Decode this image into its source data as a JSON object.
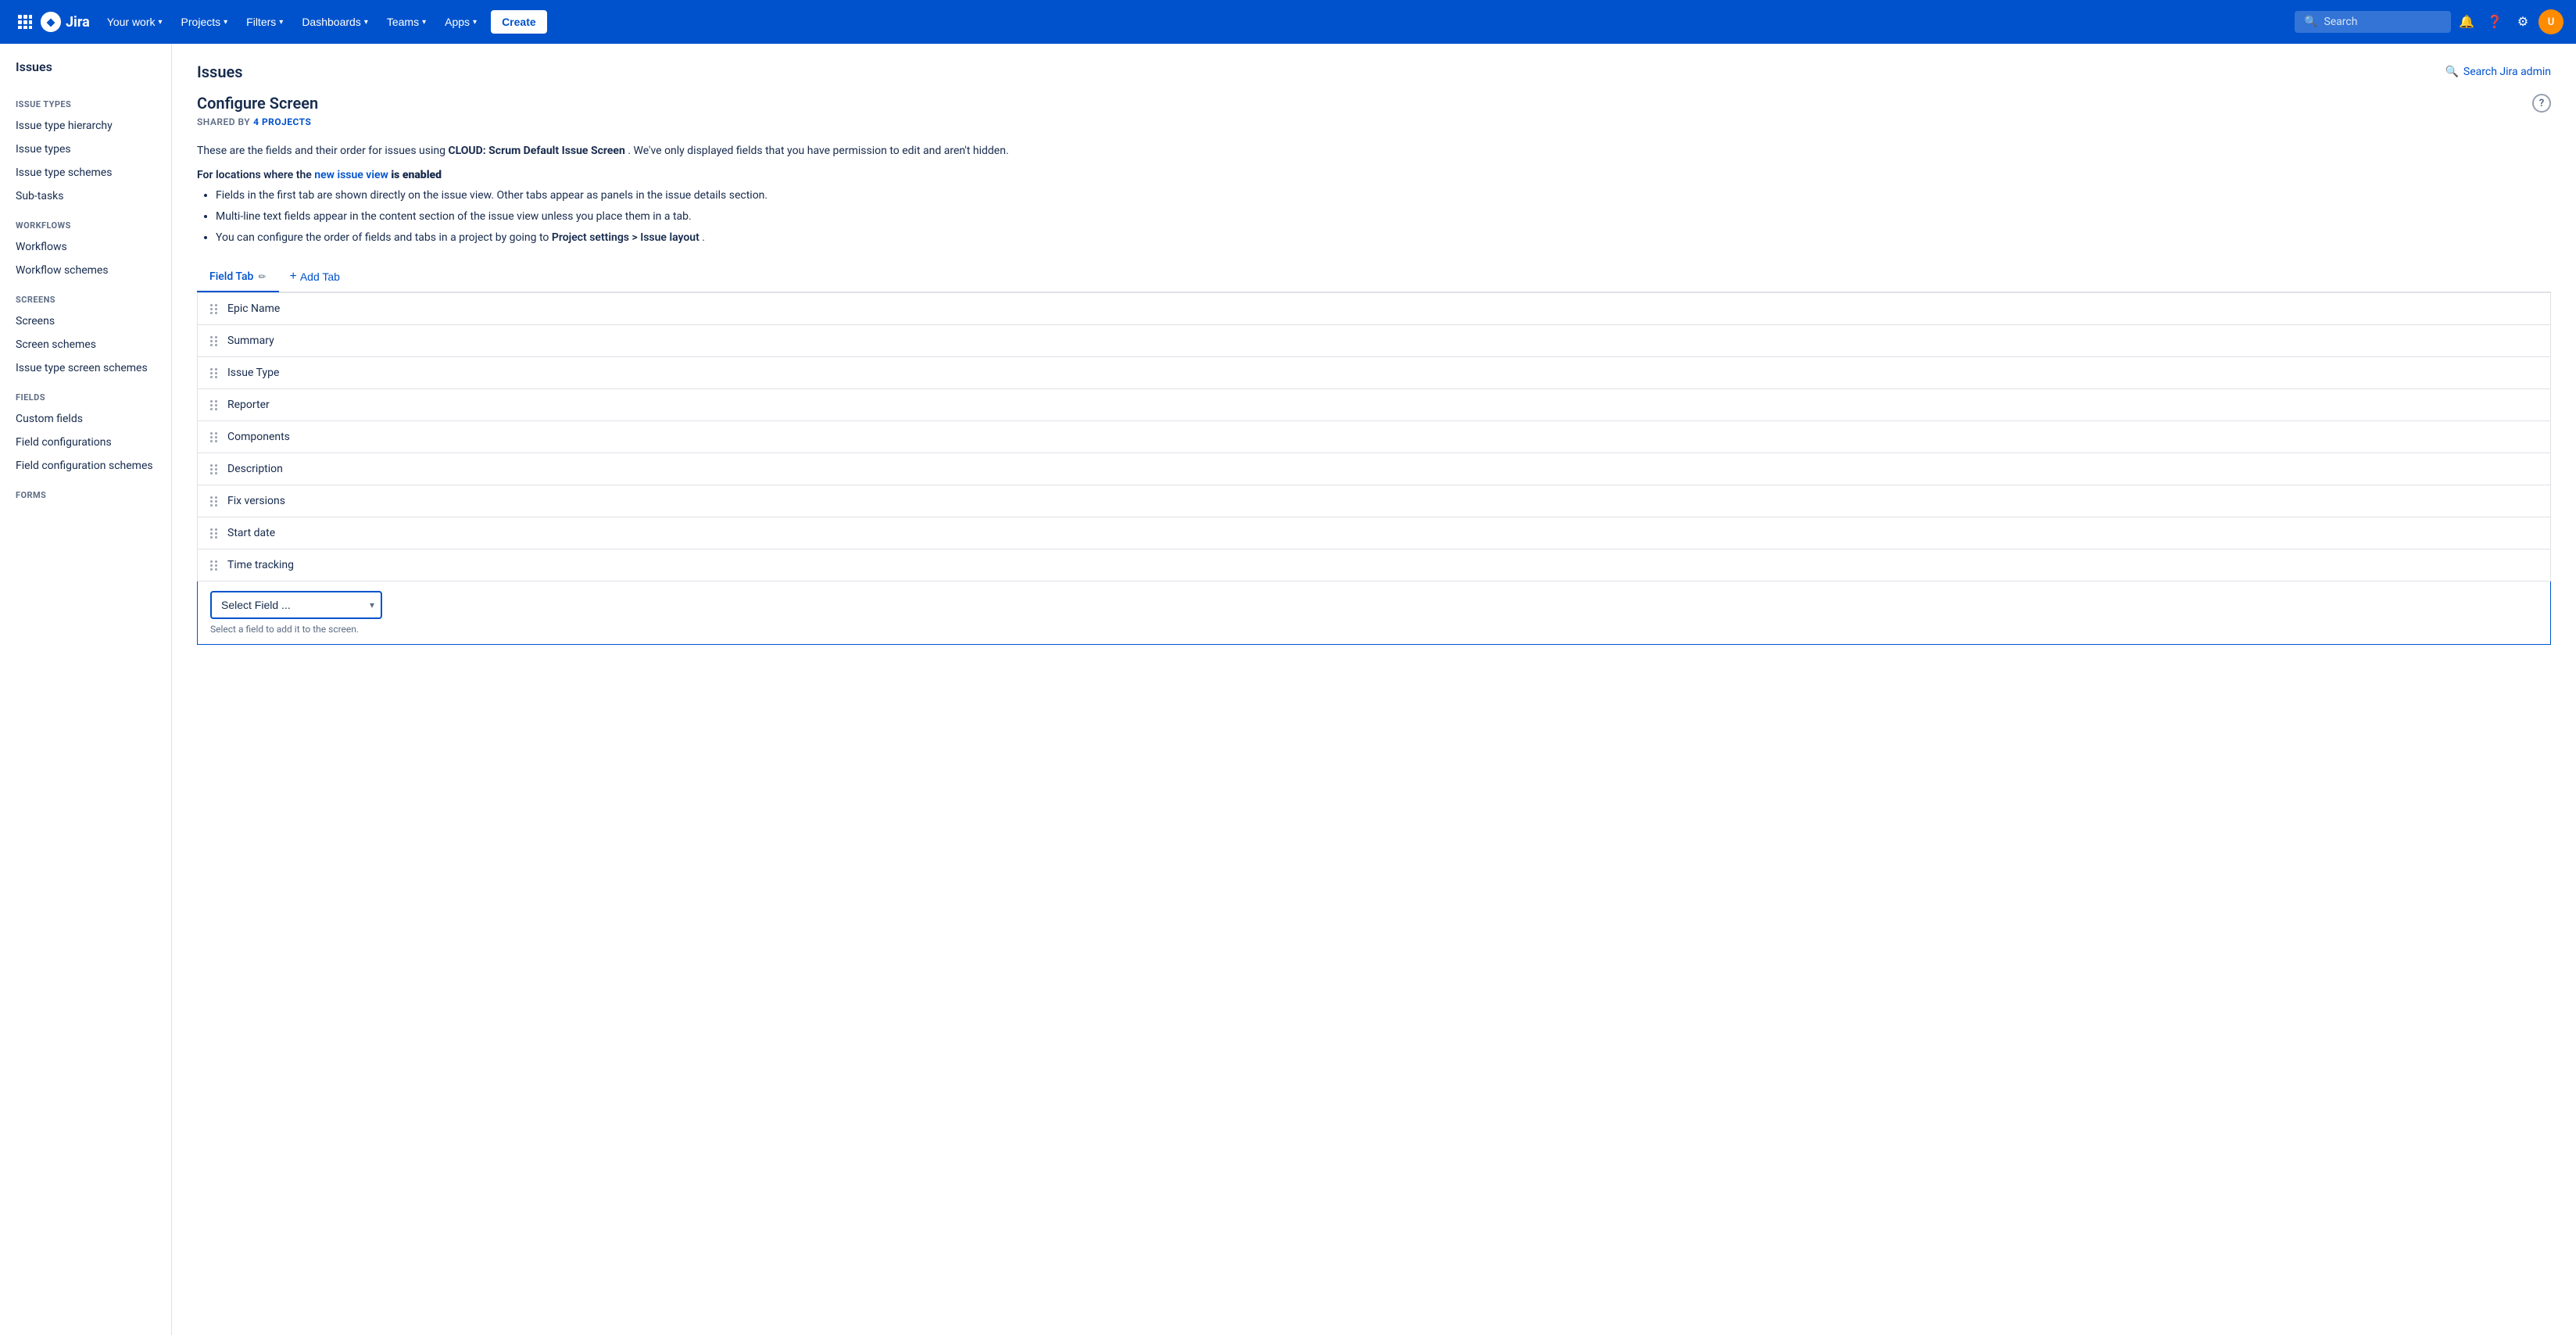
{
  "topnav": {
    "logo_text": "Jira",
    "nav_items": [
      {
        "label": "Your work",
        "id": "your-work"
      },
      {
        "label": "Projects",
        "id": "projects"
      },
      {
        "label": "Filters",
        "id": "filters"
      },
      {
        "label": "Dashboards",
        "id": "dashboards"
      },
      {
        "label": "Teams",
        "id": "teams"
      },
      {
        "label": "Apps",
        "id": "apps"
      }
    ],
    "create_label": "Create",
    "search_placeholder": "Search"
  },
  "sidebar": {
    "top_title": "Issues",
    "sections": [
      {
        "label": "Issue Types",
        "id": "issue-types",
        "items": [
          {
            "label": "Issue type hierarchy",
            "id": "issue-type-hierarchy",
            "active": false
          },
          {
            "label": "Issue types",
            "id": "issue-types-item",
            "active": false
          },
          {
            "label": "Issue type schemes",
            "id": "issue-type-schemes",
            "active": false
          },
          {
            "label": "Sub-tasks",
            "id": "sub-tasks",
            "active": false
          }
        ]
      },
      {
        "label": "Workflows",
        "id": "workflows",
        "items": [
          {
            "label": "Workflows",
            "id": "workflows-item",
            "active": false
          },
          {
            "label": "Workflow schemes",
            "id": "workflow-schemes",
            "active": false
          }
        ]
      },
      {
        "label": "Screens",
        "id": "screens",
        "items": [
          {
            "label": "Screens",
            "id": "screens-item",
            "active": false
          },
          {
            "label": "Screen schemes",
            "id": "screen-schemes",
            "active": false
          },
          {
            "label": "Issue type screen schemes",
            "id": "issue-type-screen-schemes",
            "active": false
          }
        ]
      },
      {
        "label": "Fields",
        "id": "fields",
        "items": [
          {
            "label": "Custom fields",
            "id": "custom-fields",
            "active": false
          },
          {
            "label": "Field configurations",
            "id": "field-configurations",
            "active": false
          },
          {
            "label": "Field configuration schemes",
            "id": "field-configuration-schemes",
            "active": false
          }
        ]
      },
      {
        "label": "Forms",
        "id": "forms",
        "items": []
      }
    ]
  },
  "main": {
    "page_title": "Issues",
    "search_jira_admin_label": "Search Jira admin",
    "configure_screen": {
      "title": "Configure Screen",
      "shared_by_label": "SHARED BY",
      "shared_by_count": "4 PROJECTS",
      "description": "These are the fields and their order for issues using",
      "screen_name": "CLOUD: Scrum Default Issue Screen",
      "description_suffix": ". We've only displayed fields that you have permission to edit and aren't hidden.",
      "new_issue_view_label": "For locations where the",
      "new_issue_view_link": "new issue view",
      "new_issue_view_suffix": "is enabled",
      "bullets": [
        "Fields in the first tab are shown directly on the issue view. Other tabs appear as panels in the issue details section.",
        "Multi-line text fields appear in the content section of the issue view unless you place them in a tab.",
        "You can configure the order of fields and tabs in a project by going to Project settings > Issue layout ."
      ],
      "tabs": [
        {
          "label": "Field Tab",
          "active": true,
          "editable": true
        },
        {
          "label": "Add Tab",
          "is_add": true
        }
      ],
      "fields": [
        {
          "label": "Epic Name"
        },
        {
          "label": "Summary"
        },
        {
          "label": "Issue Type"
        },
        {
          "label": "Reporter"
        },
        {
          "label": "Components"
        },
        {
          "label": "Description"
        },
        {
          "label": "Fix versions"
        },
        {
          "label": "Start date"
        },
        {
          "label": "Time tracking"
        }
      ],
      "select_field_placeholder": "Select Field ...",
      "select_field_hint": "Select a field to add it to the screen."
    }
  }
}
